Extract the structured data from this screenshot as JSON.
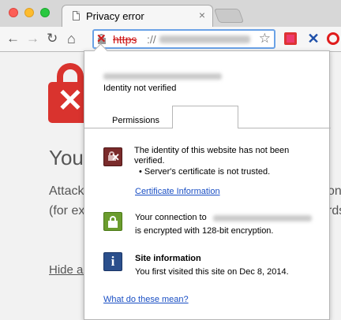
{
  "browser": {
    "tab": {
      "title": "Privacy error",
      "close": "×"
    },
    "nav": {
      "back": "←",
      "forward": "→",
      "reload": "↻",
      "home": "⌂"
    },
    "omnibox": {
      "scheme": "https",
      "separator": "://",
      "bookmark_star": "☆"
    },
    "extensions": [
      {
        "icon": "bookmarks-extension-icon",
        "color": "#d33333"
      },
      {
        "icon": "x-extension-icon",
        "glyph": "✕",
        "color": "#1e4fa8"
      },
      {
        "icon": "circle-extension-icon",
        "color": "#e01c1c"
      }
    ]
  },
  "background_page": {
    "heading": "You",
    "line1": "Attack",
    "line2": "(for ex",
    "right1": "on",
    "right2": "rds",
    "link": "Hide ad"
  },
  "popup": {
    "identity_status": "Identity not verified",
    "tabs": [
      "Permissions",
      ""
    ],
    "identity_section": {
      "line1": "The identity of this website has not been",
      "line2": "verified.",
      "bullet": "• Server's certificate is not trusted.",
      "link": "Certificate Information"
    },
    "connection_section": {
      "line1": "Your connection to",
      "line2": "is encrypted with 128-bit encryption."
    },
    "site_info": {
      "title": "Site information",
      "desc": "You first visited this site on Dec 8, 2014."
    },
    "help_link": "What do these mean?"
  },
  "colors": {
    "error_red": "#d9332e",
    "link_blue": "#1a4fc4",
    "secure_green": "#6b9c2e",
    "info_blue": "#2b4f8c"
  }
}
